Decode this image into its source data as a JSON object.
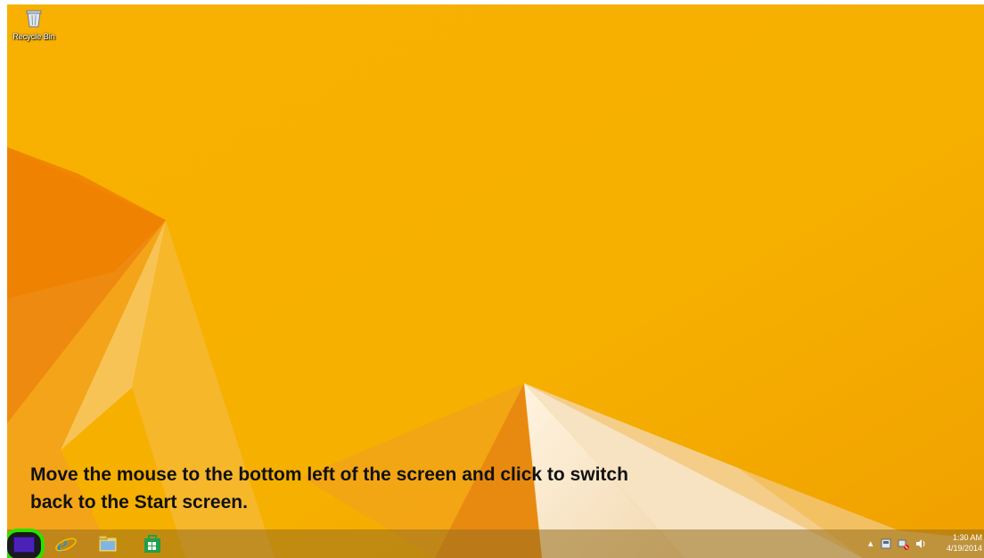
{
  "desktop": {
    "icons": [
      {
        "label": "Recycle Bin",
        "icon": "recycle-bin-icon"
      }
    ]
  },
  "instruction": {
    "line1": "Move the mouse to the bottom left of the screen and click to switch",
    "line2": "back to the Start screen."
  },
  "taskbar": {
    "pinned": [
      {
        "name": "start-button",
        "icon": "windows-start-icon",
        "highlight_color": "#2de000"
      },
      {
        "name": "internet-explorer",
        "icon": "internet-explorer-icon"
      },
      {
        "name": "file-explorer",
        "icon": "file-explorer-icon"
      },
      {
        "name": "store",
        "icon": "store-icon"
      }
    ],
    "tray": {
      "icons": [
        "show-hidden-icons-chevron-icon",
        "action-center-flag-icon",
        "network-icon",
        "volume-icon"
      ],
      "time": "1:30 AM",
      "date": "4/19/2014"
    }
  },
  "colors": {
    "wallpaper": "#f7b400",
    "highlight": "#2de000"
  }
}
